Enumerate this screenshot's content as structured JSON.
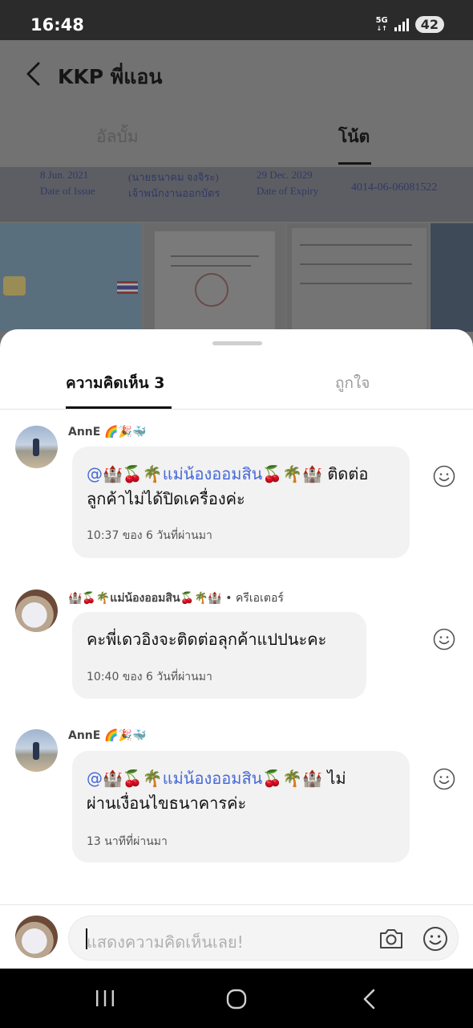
{
  "status_bar": {
    "time": "16:48",
    "network": "5G",
    "battery": "42"
  },
  "header": {
    "title": "KKP พี่แอน"
  },
  "tabs": {
    "album": "อัลบั้ม",
    "note": "โน้ต"
  },
  "photo_texts": {
    "issue_date": "8 Jun. 2021",
    "issue_label": "Date of Issue",
    "officer": "(นายธนาคม  จงจิระ)",
    "officer_title": "เจ้าพนักงานออกบัตร",
    "expiry_date": "29 Dec. 2029",
    "expiry_label": "Date of Expiry",
    "card_number": "4014-06-06081522"
  },
  "sheet": {
    "comments_tab": "ความคิดเห็น 3",
    "likes_tab": "ถูกใจ"
  },
  "comments": [
    {
      "author": "AnnE 🌈🎉🐳",
      "mention": "@🏰🍒🌴แม่น้องออมสิน🍒🌴🏰",
      "text_line1": " ติดต่อ",
      "text_line2": "ลูกค้าไม่ได้ปิดเครื่องค่ะ",
      "time": "10:37 ของ 6 วันที่ผ่านมา"
    },
    {
      "author": "🏰🍒🌴แม่น้องออมสิน🍒🌴🏰",
      "role": " • ครีเอเตอร์",
      "text_line1": "คะพี่เดวอิงจะติดต่อลุกค้าแปปนะคะ",
      "time": "10:40 ของ 6 วันที่ผ่านมา"
    },
    {
      "author": "AnnE 🌈🎉🐳",
      "mention": "@🏰🍒🌴แม่น้องออมสิน🍒🌴🏰",
      "text_line1": " ไม่",
      "text_line2": "ผ่านเงื่อนไขธนาคารค่ะ",
      "time": "13 นาทีที่ผ่านมา"
    }
  ],
  "composer": {
    "placeholder": "แสดงความคิดเห็นเลย!"
  }
}
